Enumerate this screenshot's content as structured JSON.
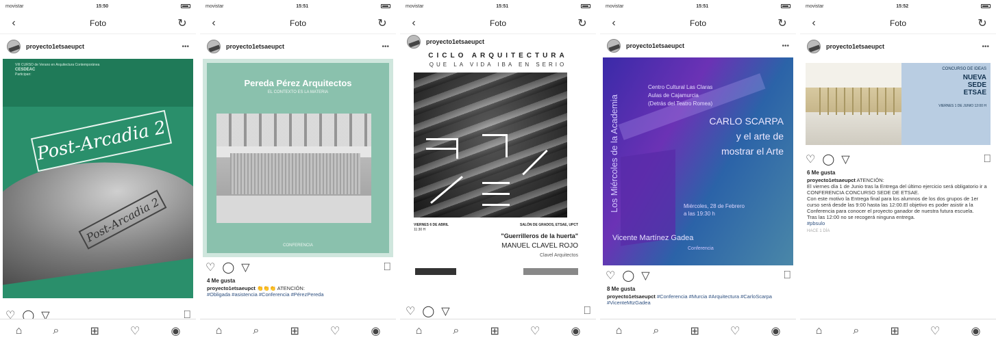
{
  "status": {
    "carriers": [
      "movistar",
      "movistar",
      "movistar",
      "movistar",
      "movistar"
    ],
    "times": [
      "15:50",
      "15:51",
      "15:51",
      "15:51",
      "15:52"
    ]
  },
  "nav": {
    "title": "Foto",
    "back_icon": "chevron-left-icon",
    "refresh_icon": "refresh-icon"
  },
  "user": "proyecto1etsaeupct",
  "posts": [
    {
      "poster": {
        "band_line1": "VIII CURSO de Verano en Arquitectura Contemporánea",
        "band_line2": "CESDEAC",
        "band_line3": "Participan:",
        "title": "Post-Arcadia 2",
        "title2": "Post-Arcadia 2"
      },
      "likes": "",
      "caption_user": "",
      "caption": ""
    },
    {
      "poster": {
        "title": "Pereda Pérez Arquitectos",
        "subtitle": "EL CONTEXTO ES LA MATERIA",
        "detail": "",
        "footer": "CONFERENCIA"
      },
      "likes": "4 Me gusta",
      "caption_user": "proyecto1etsaeupct",
      "caption_text": " 👏👏👏 ATENCIÓN:",
      "caption_tags": "#Obligada #asistencia #Conferencia #PérezPereda"
    },
    {
      "poster": {
        "h1": "CICLO ARQUITECTURA",
        "h2": "QUE LA VIDA IBA EN SERIO",
        "left": "VIERNES 6 DE ABRIL",
        "left2": "11:30 H",
        "right": "SALÓN DE GRADOS, ETSAE, UPCT",
        "talk": "\"Guerrilleros de la huerta\"",
        "speaker": "MANUEL CLAVEL ROJO",
        "firm": "Clavel Arquitectos"
      }
    },
    {
      "poster": {
        "vertical": "Los Miércoles de la Academia",
        "venue1": "Centro Cultural Las Claras",
        "venue2": "Aulas de Cajamurcia",
        "venue3": "(Detrás del Teatro Romea)",
        "title1": "CARLO SCARPA",
        "title2": "y el arte de",
        "title3": "mostrar el Arte",
        "date1": "Miércoles, 28 de Febrero",
        "date2": "a las 19:30 h",
        "name": "Vicente Martínez Gadea",
        "type": "Conferencia"
      },
      "likes": "8 Me gusta",
      "caption_user": "proyecto1etsaeupct",
      "caption_tags": "#Conferencia #Murcia #Arquitectura #CarloScarpa #VicenteMtzGadea"
    },
    {
      "poster": {
        "concurso": "CONCURSO DE IDEAS",
        "nueva": "NUEVA",
        "sede": "SEDE",
        "etsae": "ETSAE",
        "info": "VIERNES 1 DE JUNIO 12:00 H"
      },
      "likes": "6 Me gusta",
      "caption_user": "proyecto1etsaeupct",
      "caption_lines": [
        "ATENCIÓN:",
        "El viernes día 1 de Junio tras la Entrega del último ejercicio será obligatorio ir a CONFERENCIA CONCURSO SEDE DE ETSAE.",
        "Con este motivo la Entrega final para los alumnos de los dos grupos de 1er curso será desde las 9:00 hasta las 12:00.El objetivo es poder asistir a la Conferencia para conocer el proyecto ganador de nuestra futura escuela.",
        "Tras las 12:00 no se recogerá ninguna entrega.",
        "#pbsulo"
      ],
      "time_ago": "HACE 1 DÍA"
    }
  ],
  "tabbar": [
    "home-icon",
    "search-icon",
    "add-icon",
    "heart-icon",
    "profile-icon"
  ]
}
